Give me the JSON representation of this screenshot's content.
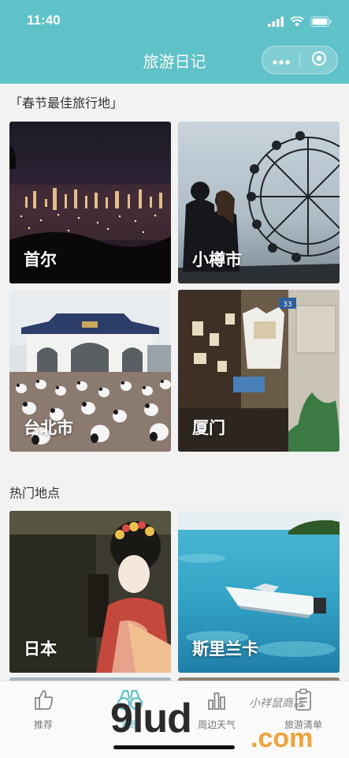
{
  "status_bar": {
    "time": "11:40"
  },
  "nav": {
    "title": "旅游日记"
  },
  "sections": [
    {
      "title": "「春节最佳旅行地」",
      "cards": [
        {
          "label": "首尔"
        },
        {
          "label": "小樽市"
        },
        {
          "label": "台北市"
        },
        {
          "label": "厦门"
        }
      ]
    },
    {
      "title": "热门地点",
      "cards": [
        {
          "label": "日本"
        },
        {
          "label": "斯里兰卡"
        }
      ]
    }
  ],
  "tabbar": {
    "items": [
      {
        "label": "推荐",
        "icon": "thumbs-up-icon"
      },
      {
        "label": "发现",
        "icon": "binoculars-icon"
      },
      {
        "label": "周边天气",
        "icon": "bar-chart-icon"
      },
      {
        "label": "旅游清单",
        "icon": "clipboard-icon"
      }
    ]
  },
  "watermark": {
    "main": "9lud",
    "suffix": ".com",
    "sub": "小祥鼠商店"
  },
  "colors": {
    "header": "#5ec2c8",
    "background": "#f2f2f2"
  }
}
